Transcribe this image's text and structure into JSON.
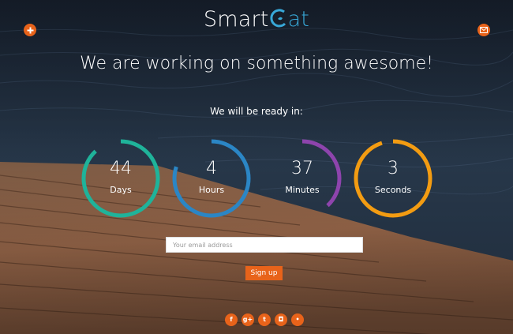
{
  "header": {
    "logo_main": "Smart",
    "logo_tail": "at",
    "logo_mark_icon": "cat-c-swirl-icon",
    "left_button_icon": "plus-icon",
    "right_button_icon": "envelope-icon"
  },
  "main": {
    "headline": "We are working on something awesome!",
    "ready_text": "We will be ready in:",
    "countdown": [
      {
        "value": "44",
        "unit": "Days",
        "color": "#1fb39a",
        "progress": 0.88
      },
      {
        "value": "4",
        "unit": "Hours",
        "color": "#2b86c5",
        "progress": 0.8
      },
      {
        "value": "37",
        "unit": "Minutes",
        "color": "#8e44ad",
        "progress": 0.38
      },
      {
        "value": "3",
        "unit": "Seconds",
        "color": "#f39c12",
        "progress": 0.95
      }
    ]
  },
  "signup": {
    "placeholder": "Your email address",
    "button_label": "Sign up"
  },
  "social": [
    {
      "name": "facebook-icon",
      "glyph": "f"
    },
    {
      "name": "google-plus-icon",
      "glyph": "g+"
    },
    {
      "name": "twitter-icon",
      "glyph": "t"
    },
    {
      "name": "instagram-icon",
      "glyph": "◘"
    },
    {
      "name": "flickr-icon",
      "glyph": "•"
    }
  ],
  "colors": {
    "accent": "#e8631a",
    "logo_accent": "#38a8d8"
  }
}
